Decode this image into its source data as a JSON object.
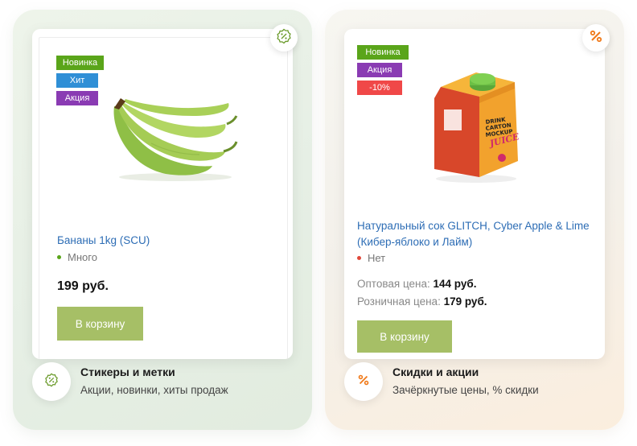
{
  "colors": {
    "accent_green": "#a6bf66",
    "link_blue": "#2d6db5",
    "sticker_new": "#5aa51a",
    "sticker_hit": "#2f8fd6",
    "sticker_sale": "#8a3bb3",
    "sticker_discount": "#f04848",
    "icon_green": "#6a9a2a",
    "icon_orange": "#f07a1a"
  },
  "left": {
    "stickers": [
      "Новинка",
      "Хит",
      "Акция"
    ],
    "product": {
      "image": "banana-image",
      "title": "Бананы 1kg (SCU)",
      "stock": "Много",
      "price": "199 руб.",
      "cart_label": "В корзину"
    },
    "feature": {
      "icon": "badge-percent-icon",
      "title": "Стикеры и метки",
      "subtitle": "Акции, новинки, хиты продаж"
    }
  },
  "right": {
    "stickers": [
      "Новинка",
      "Акция",
      "-10%"
    ],
    "product": {
      "image": "juice-carton-image",
      "carton_text": [
        "DRINK",
        "CARTON",
        "MOCKUP",
        "JUICE"
      ],
      "title": "Натуральный сок GLITCH, Cyber Apple & Lime (Кибер-яблоко и Лайм)",
      "stock": "Нет",
      "wholesale_label": "Оптовая цена:",
      "wholesale_price": "144 руб.",
      "retail_label": "Розничная цена:",
      "retail_price": "179 руб.",
      "cart_label": "В корзину"
    },
    "feature": {
      "icon": "percent-icon",
      "title": "Скидки и акции",
      "subtitle": "Зачёркнутые цены, % скидки"
    }
  }
}
